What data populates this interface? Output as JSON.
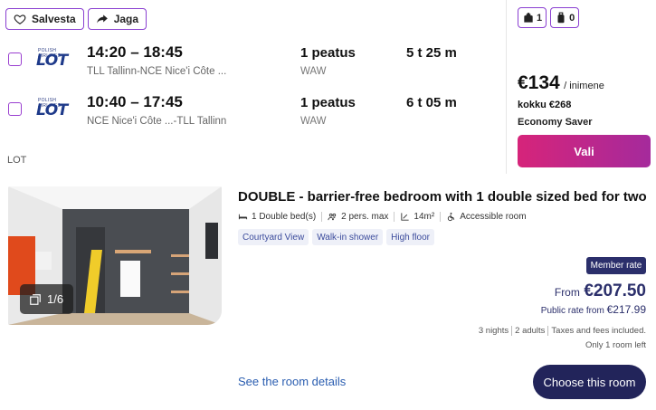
{
  "flight": {
    "save_label": "Salvesta",
    "share_label": "Jaga",
    "legs": [
      {
        "times": "14:20 – 18:45",
        "route": "TLL Tallinn-NCE Nice'i Côte ...",
        "stops": "1 peatus",
        "via": "WAW",
        "duration": "5 t 25 m"
      },
      {
        "times": "10:40 – 17:45",
        "route": "NCE Nice'i Côte ...-TLL Tallinn",
        "stops": "1 peatus",
        "via": "WAW",
        "duration": "6 t 05 m"
      }
    ],
    "airline_logo_text": "LOT",
    "airline_logo_small": "POLISH AIRLINES",
    "carrier": "LOT",
    "bags": [
      {
        "icon": "backpack-icon",
        "count": "1"
      },
      {
        "icon": "suitcase-icon",
        "count": "0"
      }
    ],
    "price": "€134",
    "price_unit": "/ inimene",
    "total": "kokku €268",
    "fare_type": "Economy Saver",
    "select_label": "Vali",
    "accent_gradient": [
      "#d6247a",
      "#a52a9c"
    ]
  },
  "hotel": {
    "room_title": "DOUBLE - barrier-free bedroom with 1 double sized bed for two",
    "features": [
      {
        "icon": "bed-icon",
        "label": "1 Double bed(s)"
      },
      {
        "icon": "people-icon",
        "label": "2 pers. max"
      },
      {
        "icon": "area-icon",
        "label": "14m²"
      },
      {
        "icon": "wheelchair-icon",
        "label": "Accessible room"
      }
    ],
    "tags": [
      "Courtyard View",
      "Walk-in shower",
      "High floor"
    ],
    "photo_counter": "1/6",
    "member_rate": "Member rate",
    "from_label": "From",
    "price": "€207.50",
    "public_rate_label": "Public rate from",
    "public_rate": "€217.99",
    "stay_meta": [
      "3 nights",
      "2 adults",
      "Taxes and fees included."
    ],
    "availability": "Only 1 room left",
    "details_link": "See the room details",
    "choose_label": "Choose this room",
    "brand_color": "#22245a"
  }
}
